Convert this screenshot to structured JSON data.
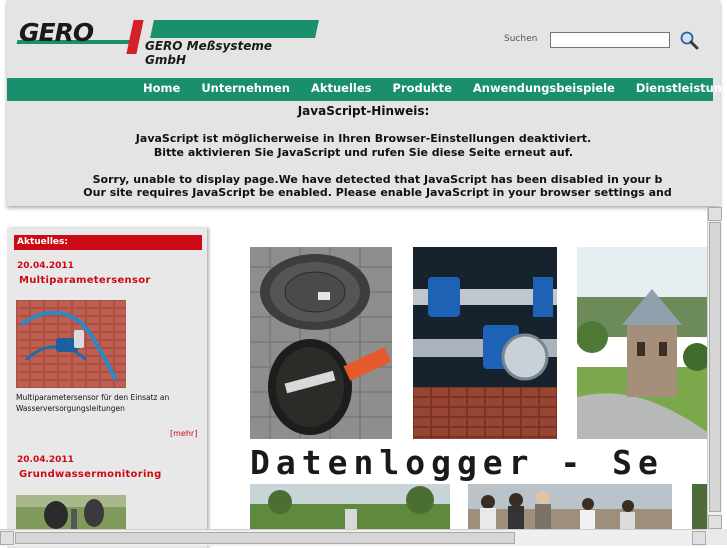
{
  "header": {
    "logo_text": "GERO",
    "company_name": "GERO Meßsysteme GmbH",
    "brand_colors": {
      "green": "#1a8f6e",
      "red": "#cc0a16"
    }
  },
  "search": {
    "label": "Suchen",
    "value": "",
    "placeholder": "",
    "icon": "magnifier-icon"
  },
  "nav": {
    "items": [
      "Home",
      "Unternehmen",
      "Aktuelles",
      "Produkte",
      "Anwendungsbeispiele",
      "Dienstleistung"
    ]
  },
  "js_notice": {
    "title": "JavaScript-Hinweis:",
    "line1": "JavaScript ist möglicherweise in Ihren Browser-Einstellungen deaktiviert.",
    "line2": "Bitte aktivieren Sie JavaScript und rufen Sie diese Seite erneut auf.",
    "line3": "Sorry, unable to display page.We have detected that JavaScript has been disabled in your b",
    "line4": "Our site requires JavaScript be enabled. Please enable JavaScript in your browser settings and"
  },
  "sidebar": {
    "heading": "Aktuelles:",
    "news": [
      {
        "date": "20.04.2011",
        "title": "Multiparametersensor",
        "text": "Multiparametersensor für den Einsatz an Wasserversorgungsleitungen",
        "more": "[mehr]"
      },
      {
        "date": "20.04.2011",
        "title": "Grundwassermonitoring"
      }
    ]
  },
  "main": {
    "banner_text": "Datenlogger - Se"
  }
}
